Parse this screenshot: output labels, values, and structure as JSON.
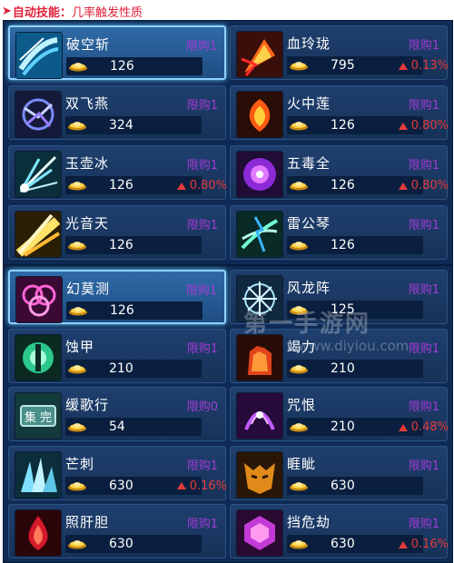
{
  "header": {
    "arrow": "➤",
    "label": "自动技能",
    "separator": "：",
    "text": "几率触发性质"
  },
  "skills": [
    {
      "name": "破空斩",
      "limit": "限购1",
      "price": "126",
      "pct": "",
      "icon": "wind-slash-icon",
      "selected": true
    },
    {
      "name": "血玲珑",
      "limit": "限购1",
      "price": "795",
      "pct": "0.13%",
      "icon": "blood-fire-icon"
    },
    {
      "name": "双飞燕",
      "limit": "限购1",
      "price": "324",
      "pct": "",
      "icon": "twin-swallow-icon"
    },
    {
      "name": "火中莲",
      "limit": "限购1",
      "price": "126",
      "pct": "0.80%",
      "icon": "fire-lotus-icon"
    },
    {
      "name": "玉壶冰",
      "limit": "限购1",
      "price": "126",
      "pct": "0.80%",
      "icon": "ice-shards-icon"
    },
    {
      "name": "五毒全",
      "limit": "限购1",
      "price": "126",
      "pct": "0.80%",
      "icon": "poison-orb-icon"
    },
    {
      "name": "光音天",
      "limit": "限购1",
      "price": "126",
      "pct": "",
      "icon": "light-beam-icon"
    },
    {
      "name": "雷公琴",
      "limit": "限购1",
      "price": "126",
      "pct": "",
      "icon": "thunder-harp-icon"
    },
    {
      "name": "幻莫测",
      "limit": "限购1",
      "price": "126",
      "pct": "",
      "icon": "illusion-icon",
      "selected": true
    },
    {
      "name": "风龙阵",
      "limit": "限购1",
      "price": "125",
      "pct": "",
      "icon": "wind-dragon-icon"
    },
    {
      "name": "蚀甲",
      "limit": "限购1",
      "price": "210",
      "pct": "",
      "icon": "corrode-armor-icon"
    },
    {
      "name": "竭力",
      "limit": "限购1",
      "price": "210",
      "pct": "",
      "icon": "exhaust-fist-icon"
    },
    {
      "name": "缓歌行",
      "limit": "限购0",
      "price": "54",
      "pct": "",
      "icon": "seal-scroll-icon"
    },
    {
      "name": "咒恨",
      "limit": "限购1",
      "price": "210",
      "pct": "0.48%",
      "icon": "curse-icon"
    },
    {
      "name": "芒刺",
      "limit": "限购1",
      "price": "630",
      "pct": "0.16%",
      "icon": "thorn-icon"
    },
    {
      "name": "睚眦",
      "limit": "限购1",
      "price": "630",
      "pct": "",
      "icon": "beast-mask-icon"
    },
    {
      "name": "照肝胆",
      "limit": "限购1",
      "price": "630",
      "pct": "",
      "icon": "blood-drop-icon"
    },
    {
      "name": "挡危劫",
      "limit": "限购1",
      "price": "630",
      "pct": "0.16%",
      "icon": "shield-gem-icon"
    }
  ],
  "watermark": {
    "line1": "第一手游网",
    "line2": "www.diyiou.com"
  },
  "colors": {
    "limit": "#a23bd6",
    "increase": "#e63a3a",
    "header": "#e0203a"
  }
}
